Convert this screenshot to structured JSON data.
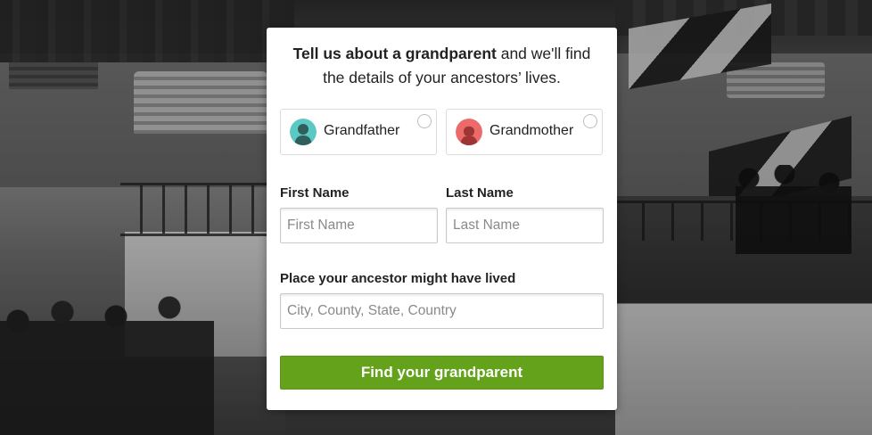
{
  "headline": {
    "bold": "Tell us about a grandparent",
    "rest": " and we'll find the details of your ancestors’ lives."
  },
  "choices": [
    {
      "label": "Grandfather",
      "icon": "male-silhouette-icon",
      "icon_color": "#5bc8c4",
      "selected": false
    },
    {
      "label": "Grandmother",
      "icon": "female-silhouette-icon",
      "icon_color": "#ec6a6a",
      "selected": false
    }
  ],
  "fields": {
    "first_name": {
      "label": "First Name",
      "placeholder": "First Name",
      "value": ""
    },
    "last_name": {
      "label": "Last Name",
      "placeholder": "Last Name",
      "value": ""
    },
    "place": {
      "label": "Place your ancestor might have lived",
      "placeholder": "City, County, State, Country",
      "value": ""
    }
  },
  "submit": {
    "label": "Find your grandparent",
    "color": "#63a21a"
  }
}
